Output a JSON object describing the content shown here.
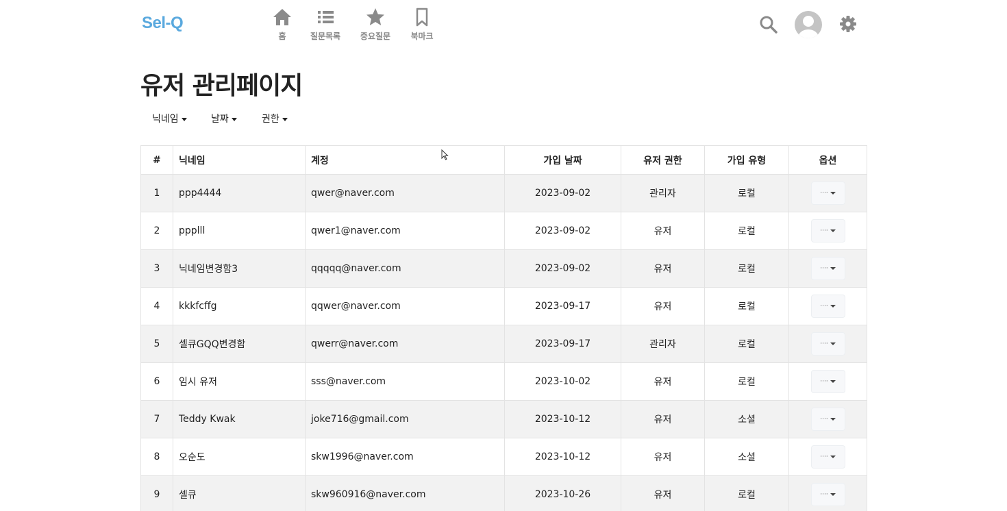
{
  "app": {
    "logo": "Sel-Q",
    "nav": [
      {
        "label": "홈",
        "icon": "home-icon"
      },
      {
        "label": "질문목록",
        "icon": "list-icon"
      },
      {
        "label": "중요질문",
        "icon": "star-icon"
      },
      {
        "label": "북마크",
        "icon": "bookmark-icon"
      }
    ],
    "right_icons": [
      "search-icon",
      "avatar-icon",
      "gear-icon"
    ],
    "accent_color": "#5aa9de"
  },
  "page": {
    "title": "유저 관리페이지",
    "filters": [
      "닉네임",
      "날짜",
      "권한"
    ]
  },
  "table": {
    "headers": [
      "#",
      "닉네임",
      "계정",
      "가입 날짜",
      "유저 권한",
      "가입 유형",
      "옵션"
    ],
    "option_label": "····",
    "rows": [
      {
        "no": "1",
        "nickname": "ppp4444",
        "account": "qwer@naver.com",
        "joined": "2023-09-02",
        "role": "관리자",
        "type": "로컬"
      },
      {
        "no": "2",
        "nickname": "ppplll",
        "account": "qwer1@naver.com",
        "joined": "2023-09-02",
        "role": "유저",
        "type": "로컬"
      },
      {
        "no": "3",
        "nickname": "닉네임변경함3",
        "account": "qqqqq@naver.com",
        "joined": "2023-09-02",
        "role": "유저",
        "type": "로컬"
      },
      {
        "no": "4",
        "nickname": "kkkfcffg",
        "account": "qqwer@naver.com",
        "joined": "2023-09-17",
        "role": "유저",
        "type": "로컬"
      },
      {
        "no": "5",
        "nickname": "셀큐GQQ변경함",
        "account": "qwerr@naver.com",
        "joined": "2023-09-17",
        "role": "관리자",
        "type": "로컬"
      },
      {
        "no": "6",
        "nickname": "임시 유저",
        "account": "sss@naver.com",
        "joined": "2023-10-02",
        "role": "유저",
        "type": "로컬"
      },
      {
        "no": "7",
        "nickname": "Teddy Kwak",
        "account": "joke716@gmail.com",
        "joined": "2023-10-12",
        "role": "유저",
        "type": "소셜"
      },
      {
        "no": "8",
        "nickname": "오순도",
        "account": "skw1996@naver.com",
        "joined": "2023-10-12",
        "role": "유저",
        "type": "소셜"
      },
      {
        "no": "9",
        "nickname": "셀큐",
        "account": "skw960916@naver.com",
        "joined": "2023-10-26",
        "role": "유저",
        "type": "로컬"
      }
    ]
  }
}
